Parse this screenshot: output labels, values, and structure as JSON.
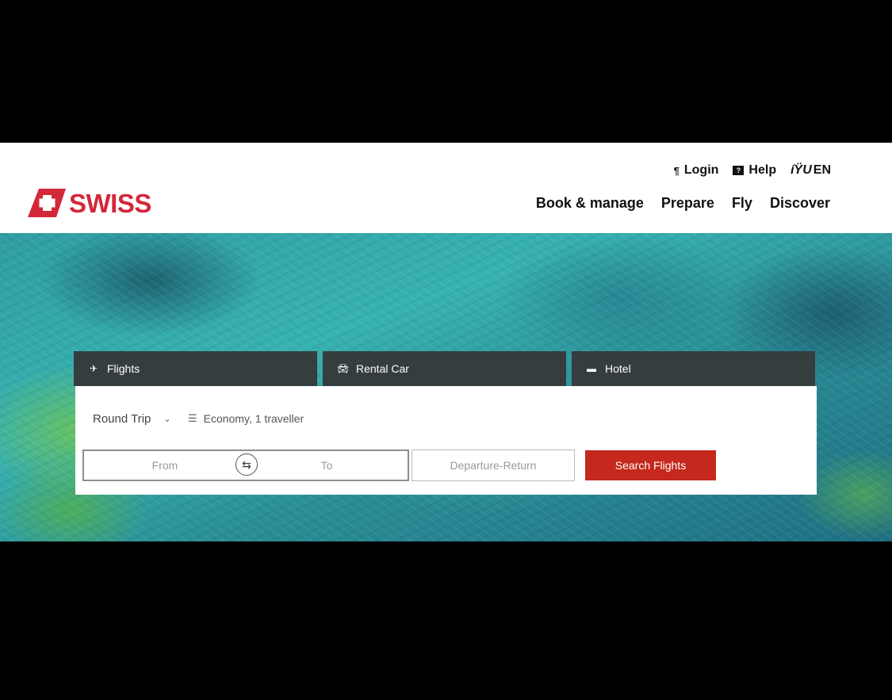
{
  "brand": {
    "name": "SWISS",
    "accent": "#d3283a"
  },
  "utility_nav": {
    "login_label": "Login",
    "login_icon": "person-icon",
    "help_label": "Help",
    "help_icon": "help-chat-icon",
    "language_label": "EN",
    "language_icon": "globe-icon"
  },
  "main_nav": {
    "items": [
      "Book & manage",
      "Prepare",
      "Fly",
      "Discover"
    ]
  },
  "booking": {
    "tabs": [
      {
        "label": "Flights",
        "icon": "plane-icon"
      },
      {
        "label": "Rental Car",
        "icon": "car-icon"
      },
      {
        "label": "Hotel",
        "icon": "bed-icon"
      }
    ],
    "trip_type": "Round Trip",
    "cabin_travellers": "Economy, 1 traveller",
    "from_placeholder": "From",
    "to_placeholder": "To",
    "dates_placeholder": "Departure-Return",
    "search_label": "Search Flights",
    "search_color": "#c5281c",
    "tab_color": "#353d3e"
  }
}
